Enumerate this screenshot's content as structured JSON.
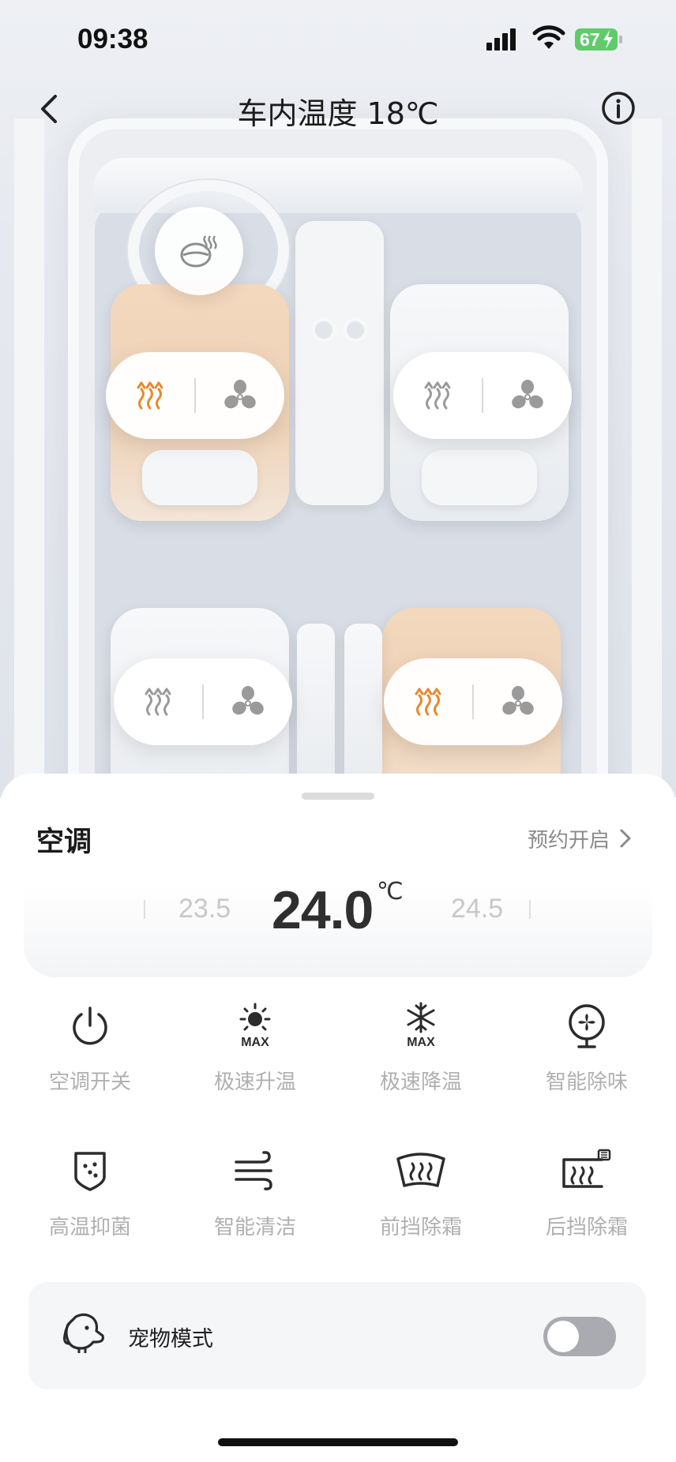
{
  "status": {
    "time": "09:38",
    "battery": "67"
  },
  "nav": {
    "title": "车内温度 18℃"
  },
  "icons": {
    "back": "chevron-left-icon",
    "info": "info-icon",
    "steering_heat": "steering-wheel-heat-icon",
    "seat_heat": "seat-heat-icon",
    "seat_vent": "fan-icon"
  },
  "seats": [
    {
      "position": "front-left",
      "heat_on": true,
      "vent_on": false
    },
    {
      "position": "front-right",
      "heat_on": false,
      "vent_on": false
    },
    {
      "position": "rear-left",
      "heat_on": false,
      "vent_on": false
    },
    {
      "position": "rear-right",
      "heat_on": true,
      "vent_on": false
    }
  ],
  "colors": {
    "heat_active": "#e8892f",
    "inactive_icon": "#9a9a9a",
    "battery": "#5fcb6b",
    "toggle_off": "#a9abb0"
  },
  "ac": {
    "title": "空调",
    "schedule_label": "预约开启",
    "temp_prev": "23.5",
    "temp_current": "24.0",
    "temp_unit": "℃",
    "temp_next": "24.5"
  },
  "functions": [
    {
      "label": "空调开关",
      "icon": "power-icon"
    },
    {
      "label": "极速升温",
      "icon": "sun-max-icon"
    },
    {
      "label": "极速降温",
      "icon": "snowflake-max-icon"
    },
    {
      "label": "智能除味",
      "icon": "fan-purify-icon"
    },
    {
      "label": "高温抑菌",
      "icon": "shield-sterilize-icon"
    },
    {
      "label": "智能清洁",
      "icon": "wind-clean-icon"
    },
    {
      "label": "前挡除霜",
      "icon": "front-defrost-icon"
    },
    {
      "label": "后挡除霜",
      "icon": "rear-defrost-icon"
    }
  ],
  "pet_mode": {
    "label": "宠物模式",
    "enabled": false
  }
}
